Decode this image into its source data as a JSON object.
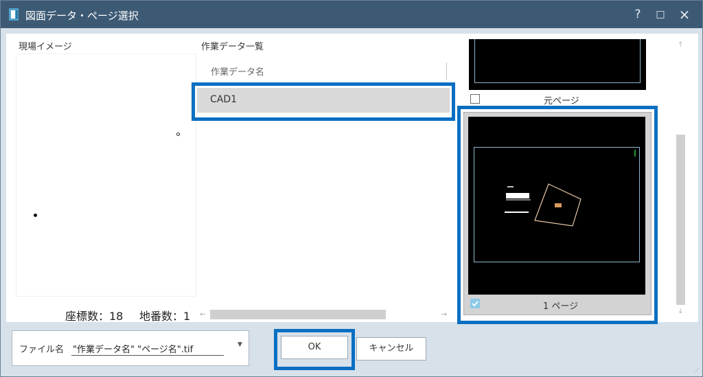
{
  "window": {
    "title": "図面データ・ページ選択",
    "help_label": "?",
    "maximize_label": "□",
    "close_label": "×"
  },
  "left_panel": {
    "title": "現場イメージ",
    "coord_count_label": "座標数：18",
    "lot_count_label": "地番数：1"
  },
  "middle_panel": {
    "title": "作業データ一覧",
    "column_header": "作業データ名",
    "rows": [
      "CAD1"
    ]
  },
  "pages_panel": {
    "pages": [
      {
        "label": "元ページ",
        "checked": false
      },
      {
        "label": "1 ページ",
        "checked": true
      }
    ]
  },
  "footer": {
    "file_label": "ファイル名",
    "file_value": "\"作業データ名\" \"ページ名\".tif",
    "ok_label": "OK",
    "cancel_label": "キャンセル"
  },
  "colors": {
    "titlebar": "#3d5a75",
    "highlight": "#0a6fc2",
    "selection": "#d9d9d9"
  }
}
